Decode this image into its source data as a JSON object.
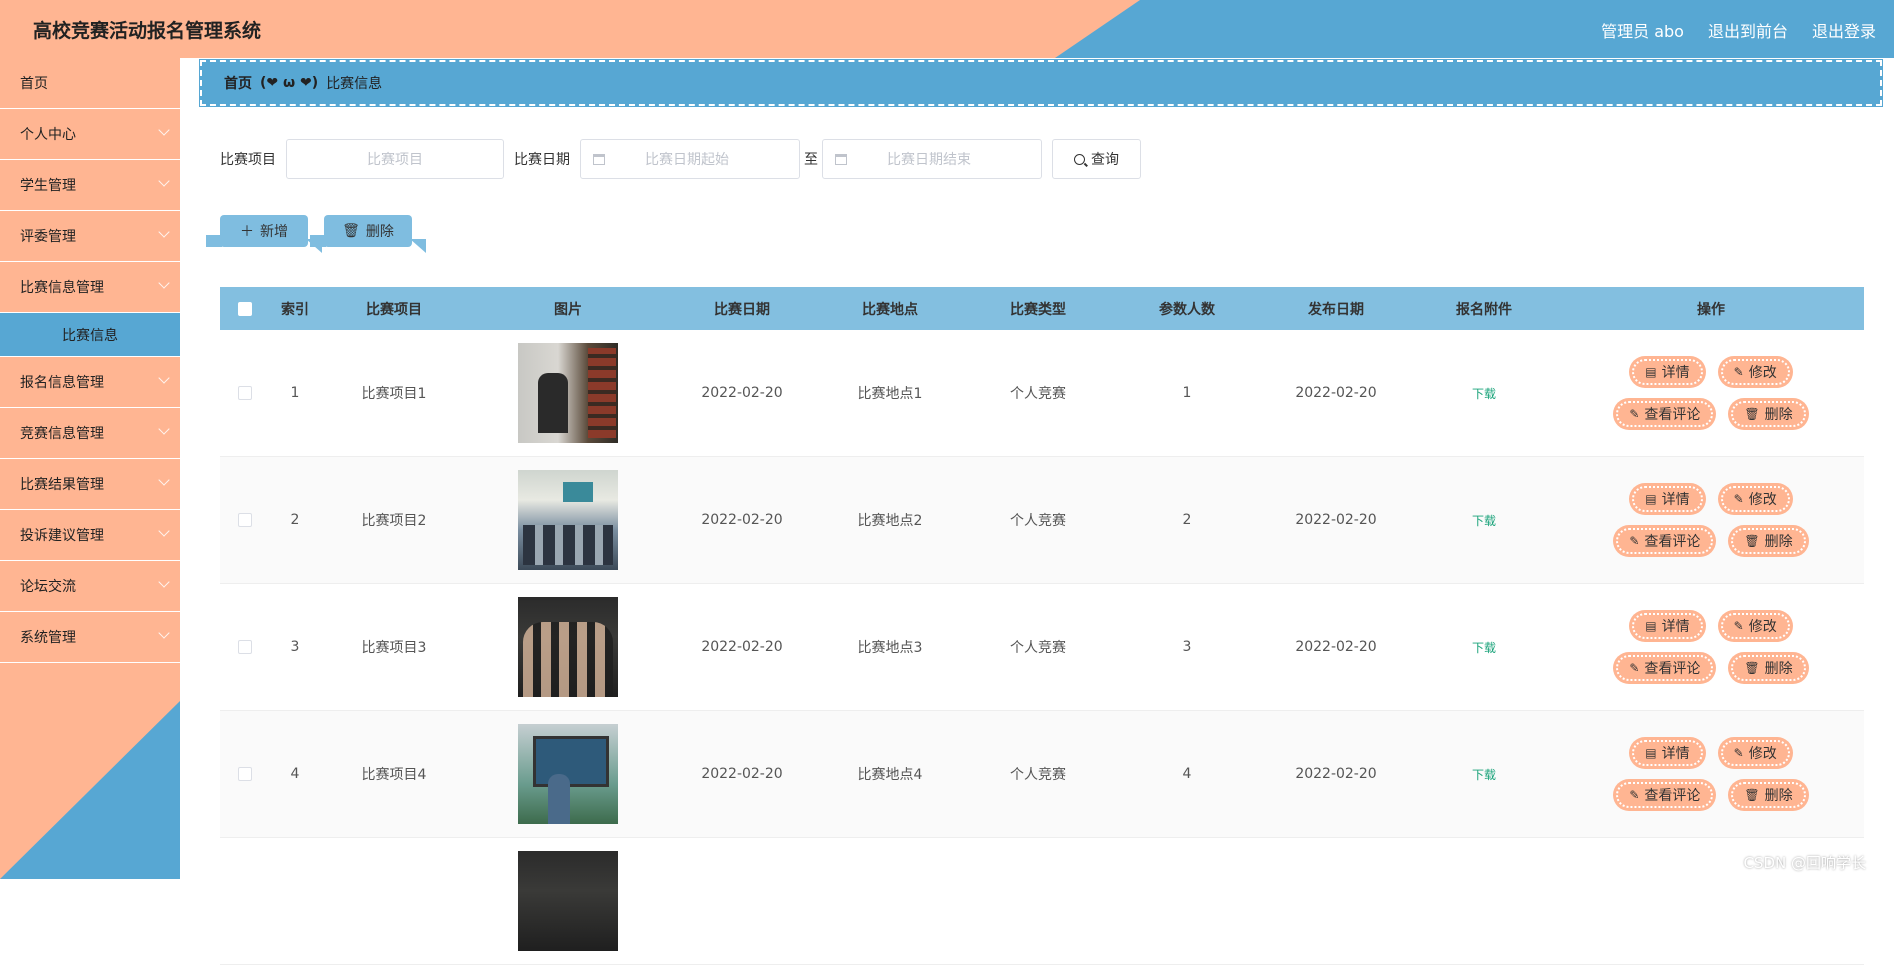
{
  "header": {
    "title": "高校竞赛活动报名管理系统",
    "user_label": "管理员 abo",
    "front_label": "退出到前台",
    "logout_label": "退出登录"
  },
  "sidebar": {
    "items": [
      {
        "label": "首页"
      },
      {
        "label": "个人中心"
      },
      {
        "label": "学生管理"
      },
      {
        "label": "评委管理"
      },
      {
        "label": "比赛信息管理"
      },
      {
        "label": "比赛信息",
        "sub": true
      },
      {
        "label": "报名信息管理"
      },
      {
        "label": "竞赛信息管理"
      },
      {
        "label": "比赛结果管理"
      },
      {
        "label": "投诉建议管理"
      },
      {
        "label": "论坛交流"
      },
      {
        "label": "系统管理"
      }
    ]
  },
  "breadcrumb": {
    "home": "首页",
    "separator": "(❤ ω ❤)",
    "current": "比赛信息"
  },
  "search": {
    "project_label": "比赛项目",
    "project_placeholder": "比赛项目",
    "date_label": "比赛日期",
    "date_start_placeholder": "比赛日期起始",
    "to_label": "至",
    "date_end_placeholder": "比赛日期结束",
    "query_label": "查询"
  },
  "actions": {
    "add_label": "新增",
    "delete_label": "删除"
  },
  "table": {
    "headers": {
      "index": "索引",
      "name": "比赛项目",
      "image": "图片",
      "date": "比赛日期",
      "location": "比赛地点",
      "type": "比赛类型",
      "count": "参数人数",
      "publish": "发布日期",
      "attachment": "报名附件",
      "ops": "操作"
    },
    "ops_labels": {
      "detail": "详情",
      "edit": "修改",
      "comments": "查看评论",
      "delete": "删除"
    },
    "rows": [
      {
        "index": "1",
        "name": "比赛项目1",
        "date": "2022-02-20",
        "location": "比赛地点1",
        "type": "个人竞赛",
        "count": "1",
        "publish": "2022-02-20",
        "attachment": "下载"
      },
      {
        "index": "2",
        "name": "比赛项目2",
        "date": "2022-02-20",
        "location": "比赛地点2",
        "type": "个人竞赛",
        "count": "2",
        "publish": "2022-02-20",
        "attachment": "下载"
      },
      {
        "index": "3",
        "name": "比赛项目3",
        "date": "2022-02-20",
        "location": "比赛地点3",
        "type": "个人竞赛",
        "count": "3",
        "publish": "2022-02-20",
        "attachment": "下载"
      },
      {
        "index": "4",
        "name": "比赛项目4",
        "date": "2022-02-20",
        "location": "比赛地点4",
        "type": "个人竞赛",
        "count": "4",
        "publish": "2022-02-20",
        "attachment": "下载"
      }
    ]
  },
  "watermark": "CSDN @回响学长",
  "colors": {
    "peach": "#ffb592",
    "blue": "#57a7d3",
    "table_header": "#83bfe0",
    "download_link": "#1aa37a"
  }
}
